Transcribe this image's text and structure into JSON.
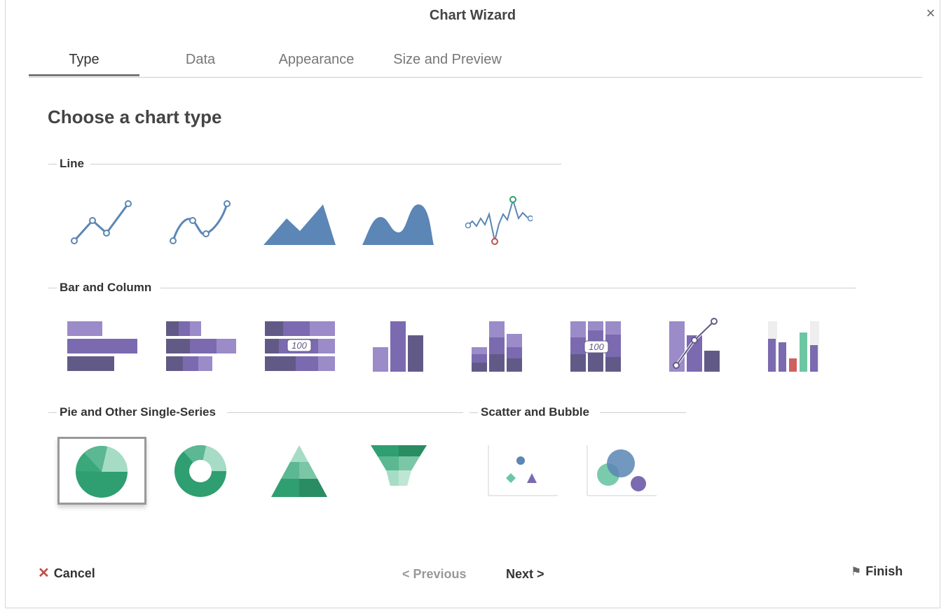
{
  "dialog": {
    "title": "Chart Wizard",
    "close_icon": "×"
  },
  "tabs": [
    {
      "label": "Type",
      "active": true
    },
    {
      "label": "Data",
      "active": false
    },
    {
      "label": "Appearance",
      "active": false
    },
    {
      "label": "Size and Preview",
      "active": false
    }
  ],
  "heading": "Choose a chart type",
  "sections": {
    "line": "Line",
    "bar": "Bar and Column",
    "pie": "Pie and Other Single-Series",
    "scatter": "Scatter and Bubble"
  },
  "icon_labels": {
    "stacked_bar_100": "100",
    "stacked_column_100": "100"
  },
  "footer": {
    "cancel_icon": "✕",
    "cancel": "Cancel",
    "previous": "< Previous",
    "next": "Next >",
    "finish_icon": "⚑",
    "finish": "Finish"
  },
  "colors": {
    "line_blue": "#5b86b5",
    "bar_purple_light": "#9b8bc8",
    "bar_purple_mid": "#7b6aaf",
    "bar_purple_dark": "#625a86",
    "pie_green_dark": "#2f9e70",
    "pie_green_mid": "#5bb892",
    "pie_green_light": "#a6dcc5",
    "cancel_red": "#c0504d"
  }
}
